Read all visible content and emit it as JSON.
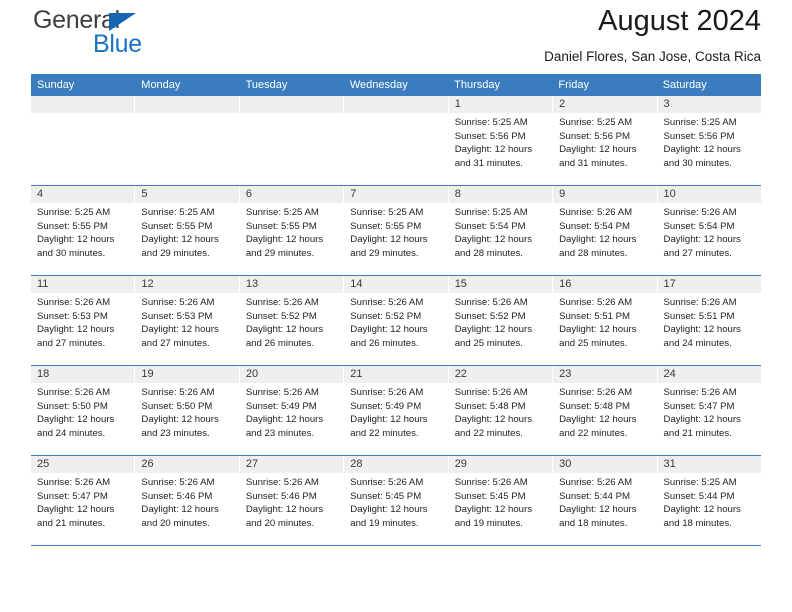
{
  "brand": {
    "word1": "General",
    "word2": "Blue",
    "triangle_color": "#1565b5",
    "text_color": "#1a73c4"
  },
  "header": {
    "title": "August 2024",
    "subtitle": "Daniel Flores, San Jose, Costa Rica"
  },
  "theme": {
    "header_bg": "#3b7cbf",
    "day_number_bg": "#efefef",
    "rule_color": "#3b7cbf"
  },
  "weekdays": [
    "Sunday",
    "Monday",
    "Tuesday",
    "Wednesday",
    "Thursday",
    "Friday",
    "Saturday"
  ],
  "weeks": [
    [
      {
        "day": "",
        "empty": true
      },
      {
        "day": "",
        "empty": true
      },
      {
        "day": "",
        "empty": true
      },
      {
        "day": "",
        "empty": true
      },
      {
        "day": "1",
        "sunrise": "Sunrise: 5:25 AM",
        "sunset": "Sunset: 5:56 PM",
        "daylight1": "Daylight: 12 hours",
        "daylight2": "and 31 minutes."
      },
      {
        "day": "2",
        "sunrise": "Sunrise: 5:25 AM",
        "sunset": "Sunset: 5:56 PM",
        "daylight1": "Daylight: 12 hours",
        "daylight2": "and 31 minutes."
      },
      {
        "day": "3",
        "sunrise": "Sunrise: 5:25 AM",
        "sunset": "Sunset: 5:56 PM",
        "daylight1": "Daylight: 12 hours",
        "daylight2": "and 30 minutes."
      }
    ],
    [
      {
        "day": "4",
        "sunrise": "Sunrise: 5:25 AM",
        "sunset": "Sunset: 5:55 PM",
        "daylight1": "Daylight: 12 hours",
        "daylight2": "and 30 minutes."
      },
      {
        "day": "5",
        "sunrise": "Sunrise: 5:25 AM",
        "sunset": "Sunset: 5:55 PM",
        "daylight1": "Daylight: 12 hours",
        "daylight2": "and 29 minutes."
      },
      {
        "day": "6",
        "sunrise": "Sunrise: 5:25 AM",
        "sunset": "Sunset: 5:55 PM",
        "daylight1": "Daylight: 12 hours",
        "daylight2": "and 29 minutes."
      },
      {
        "day": "7",
        "sunrise": "Sunrise: 5:25 AM",
        "sunset": "Sunset: 5:55 PM",
        "daylight1": "Daylight: 12 hours",
        "daylight2": "and 29 minutes."
      },
      {
        "day": "8",
        "sunrise": "Sunrise: 5:25 AM",
        "sunset": "Sunset: 5:54 PM",
        "daylight1": "Daylight: 12 hours",
        "daylight2": "and 28 minutes."
      },
      {
        "day": "9",
        "sunrise": "Sunrise: 5:26 AM",
        "sunset": "Sunset: 5:54 PM",
        "daylight1": "Daylight: 12 hours",
        "daylight2": "and 28 minutes."
      },
      {
        "day": "10",
        "sunrise": "Sunrise: 5:26 AM",
        "sunset": "Sunset: 5:54 PM",
        "daylight1": "Daylight: 12 hours",
        "daylight2": "and 27 minutes."
      }
    ],
    [
      {
        "day": "11",
        "sunrise": "Sunrise: 5:26 AM",
        "sunset": "Sunset: 5:53 PM",
        "daylight1": "Daylight: 12 hours",
        "daylight2": "and 27 minutes."
      },
      {
        "day": "12",
        "sunrise": "Sunrise: 5:26 AM",
        "sunset": "Sunset: 5:53 PM",
        "daylight1": "Daylight: 12 hours",
        "daylight2": "and 27 minutes."
      },
      {
        "day": "13",
        "sunrise": "Sunrise: 5:26 AM",
        "sunset": "Sunset: 5:52 PM",
        "daylight1": "Daylight: 12 hours",
        "daylight2": "and 26 minutes."
      },
      {
        "day": "14",
        "sunrise": "Sunrise: 5:26 AM",
        "sunset": "Sunset: 5:52 PM",
        "daylight1": "Daylight: 12 hours",
        "daylight2": "and 26 minutes."
      },
      {
        "day": "15",
        "sunrise": "Sunrise: 5:26 AM",
        "sunset": "Sunset: 5:52 PM",
        "daylight1": "Daylight: 12 hours",
        "daylight2": "and 25 minutes."
      },
      {
        "day": "16",
        "sunrise": "Sunrise: 5:26 AM",
        "sunset": "Sunset: 5:51 PM",
        "daylight1": "Daylight: 12 hours",
        "daylight2": "and 25 minutes."
      },
      {
        "day": "17",
        "sunrise": "Sunrise: 5:26 AM",
        "sunset": "Sunset: 5:51 PM",
        "daylight1": "Daylight: 12 hours",
        "daylight2": "and 24 minutes."
      }
    ],
    [
      {
        "day": "18",
        "sunrise": "Sunrise: 5:26 AM",
        "sunset": "Sunset: 5:50 PM",
        "daylight1": "Daylight: 12 hours",
        "daylight2": "and 24 minutes."
      },
      {
        "day": "19",
        "sunrise": "Sunrise: 5:26 AM",
        "sunset": "Sunset: 5:50 PM",
        "daylight1": "Daylight: 12 hours",
        "daylight2": "and 23 minutes."
      },
      {
        "day": "20",
        "sunrise": "Sunrise: 5:26 AM",
        "sunset": "Sunset: 5:49 PM",
        "daylight1": "Daylight: 12 hours",
        "daylight2": "and 23 minutes."
      },
      {
        "day": "21",
        "sunrise": "Sunrise: 5:26 AM",
        "sunset": "Sunset: 5:49 PM",
        "daylight1": "Daylight: 12 hours",
        "daylight2": "and 22 minutes."
      },
      {
        "day": "22",
        "sunrise": "Sunrise: 5:26 AM",
        "sunset": "Sunset: 5:48 PM",
        "daylight1": "Daylight: 12 hours",
        "daylight2": "and 22 minutes."
      },
      {
        "day": "23",
        "sunrise": "Sunrise: 5:26 AM",
        "sunset": "Sunset: 5:48 PM",
        "daylight1": "Daylight: 12 hours",
        "daylight2": "and 22 minutes."
      },
      {
        "day": "24",
        "sunrise": "Sunrise: 5:26 AM",
        "sunset": "Sunset: 5:47 PM",
        "daylight1": "Daylight: 12 hours",
        "daylight2": "and 21 minutes."
      }
    ],
    [
      {
        "day": "25",
        "sunrise": "Sunrise: 5:26 AM",
        "sunset": "Sunset: 5:47 PM",
        "daylight1": "Daylight: 12 hours",
        "daylight2": "and 21 minutes."
      },
      {
        "day": "26",
        "sunrise": "Sunrise: 5:26 AM",
        "sunset": "Sunset: 5:46 PM",
        "daylight1": "Daylight: 12 hours",
        "daylight2": "and 20 minutes."
      },
      {
        "day": "27",
        "sunrise": "Sunrise: 5:26 AM",
        "sunset": "Sunset: 5:46 PM",
        "daylight1": "Daylight: 12 hours",
        "daylight2": "and 20 minutes."
      },
      {
        "day": "28",
        "sunrise": "Sunrise: 5:26 AM",
        "sunset": "Sunset: 5:45 PM",
        "daylight1": "Daylight: 12 hours",
        "daylight2": "and 19 minutes."
      },
      {
        "day": "29",
        "sunrise": "Sunrise: 5:26 AM",
        "sunset": "Sunset: 5:45 PM",
        "daylight1": "Daylight: 12 hours",
        "daylight2": "and 19 minutes."
      },
      {
        "day": "30",
        "sunrise": "Sunrise: 5:26 AM",
        "sunset": "Sunset: 5:44 PM",
        "daylight1": "Daylight: 12 hours",
        "daylight2": "and 18 minutes."
      },
      {
        "day": "31",
        "sunrise": "Sunrise: 5:25 AM",
        "sunset": "Sunset: 5:44 PM",
        "daylight1": "Daylight: 12 hours",
        "daylight2": "and 18 minutes."
      }
    ]
  ]
}
